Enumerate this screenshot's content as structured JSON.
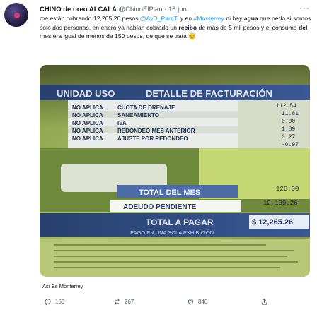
{
  "tweet": {
    "author_name": "CHINO de oreo ALCALÁ",
    "handle": "@ChinoElPlan",
    "separator": "·",
    "date": "16 jun.",
    "text_part1": "me están cobrando 12,265.26 pesos ",
    "mention": "@AyD_ParaTi",
    "text_part2": " y en ",
    "hashtag": "#Monterrey",
    "text_part3": " ni hay ",
    "text_bold1": "agua",
    "text_part4": " que pedo si somos solo dos personas, en enero ya habían cobrado un ",
    "text_bold2": "recibo",
    "text_part5": " de más de 5 mil pesos y el consumo ",
    "text_bold3": "del",
    "text_part6": " mes era igual de menos de 150 pesos, de que se trata 😒",
    "alt_caption": "Así Es Monterrey",
    "reply_count": "150",
    "retweet_count": "267",
    "like_count": "840"
  },
  "receipt": {
    "header_left": "UNIDAD USO",
    "header_right": "DETALLE DE FACTURACIÓN",
    "rows": [
      {
        "status": "NO APLICA",
        "concept": "CUOTA DE DRENAJE",
        "amount": "11.81"
      },
      {
        "status": "NO APLICA",
        "concept": "SANEAMIENTO",
        "amount": "0.00"
      },
      {
        "status": "NO APLICA",
        "concept": "IVA",
        "amount": "1.89"
      },
      {
        "status": "NO APLICA",
        "concept": "REDONDEO MES ANTERIOR",
        "amount": "0.27"
      },
      {
        "status": "NO APLICA",
        "concept": "AJUSTE POR REDONDEO",
        "amount": "-0.97"
      }
    ],
    "top_amount": "112.54",
    "total_mes_label": "TOTAL DEL MES",
    "total_mes_value": "126.00",
    "adeudo_label": "ADEUDO PENDIENTE",
    "adeudo_value": "12,139.26",
    "total_pagar_label": "TOTAL A PAGAR",
    "total_pagar_value": "$ 12,265.26",
    "pago_label": "PAGO EN UNA SOLA EXHIBICIÓN"
  },
  "colors": {
    "accent": "#1d9bf0",
    "muted": "#536471",
    "receipt_green": "#9aad4e",
    "receipt_band": "#2f4a86"
  }
}
